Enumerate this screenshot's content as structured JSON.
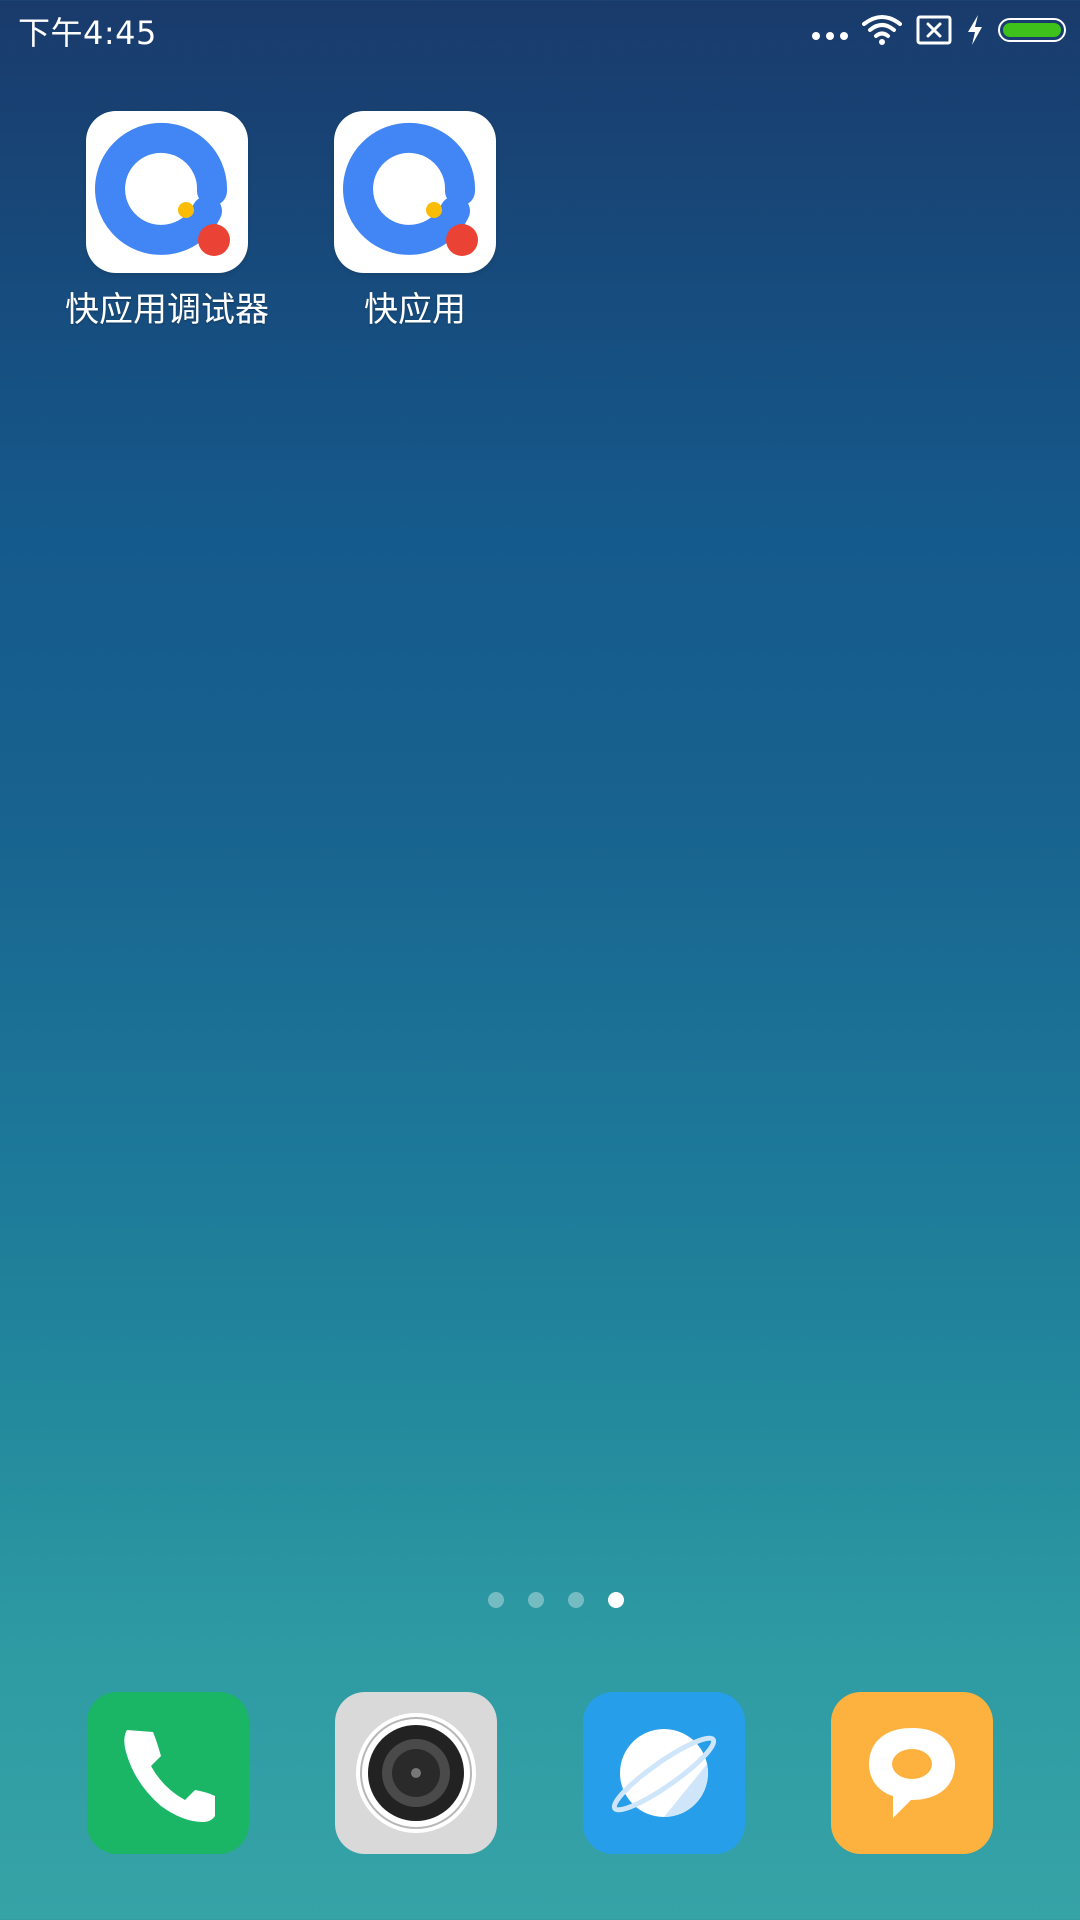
{
  "status_bar": {
    "time": "下午4:45",
    "icons": [
      "more-dots-icon",
      "wifi-icon",
      "no-sim-icon",
      "charging-icon",
      "battery-icon"
    ],
    "battery_level": 1.0,
    "battery_color": "#3fc11c"
  },
  "home": {
    "apps": [
      {
        "label": "快应用调试器",
        "icon": "quick-app-debugger-icon"
      },
      {
        "label": "快应用",
        "icon": "quick-app-icon"
      }
    ]
  },
  "page_indicator": {
    "count": 4,
    "active_index": 3
  },
  "dock": {
    "apps": [
      {
        "icon": "phone-icon",
        "color": "#1bb566"
      },
      {
        "icon": "camera-icon",
        "color": "#d9d9d9"
      },
      {
        "icon": "browser-icon",
        "color": "#279ee9"
      },
      {
        "icon": "messages-icon",
        "color": "#fdb23f"
      }
    ]
  }
}
